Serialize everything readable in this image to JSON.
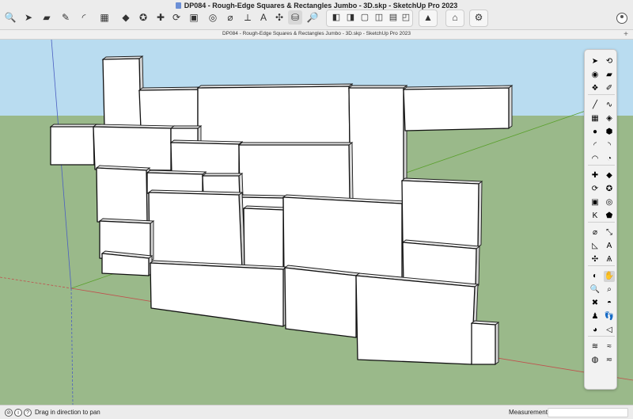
{
  "window": {
    "title": "DP084 - Rough-Edge Squares & Rectangles Jumbo - 3D.skp - SketchUp Pro 2023",
    "document_tab_title": "DP084 - Rough-Edge Squares & Rectangles Jumbo - 3D.skp - SketchUp Pro 2023",
    "new_tab_label": "+"
  },
  "toolbar": {
    "tools": [
      {
        "icon": "search-icon",
        "glyph": "🔍"
      },
      {
        "icon": "select-arrow-icon",
        "glyph": "➤"
      },
      {
        "icon": "eraser-icon",
        "glyph": "▰"
      },
      {
        "icon": "pencil-line-icon",
        "glyph": "✎"
      },
      {
        "icon": "arc-icon",
        "glyph": "◜"
      },
      {
        "icon": "rectangle-icon",
        "glyph": "▦"
      },
      {
        "icon": "push-pull-icon",
        "glyph": "◆"
      },
      {
        "icon": "follow-me-icon",
        "glyph": "✪"
      },
      {
        "icon": "move-icon",
        "glyph": "✚"
      },
      {
        "icon": "rotate-icon",
        "glyph": "⟳"
      },
      {
        "icon": "scale-icon",
        "glyph": "▣"
      },
      {
        "icon": "offset-icon",
        "glyph": "◎"
      },
      {
        "icon": "tape-measure-icon",
        "glyph": "⌀"
      },
      {
        "icon": "dimension-icon",
        "glyph": "⟂"
      },
      {
        "icon": "text-icon",
        "glyph": "A"
      },
      {
        "icon": "axes-icon",
        "glyph": "✣"
      },
      {
        "icon": "paint-bucket-icon",
        "glyph": "⛁"
      },
      {
        "icon": "zoom-icon",
        "glyph": "🔎"
      }
    ],
    "view_tools": [
      {
        "icon": "iso-view-icon",
        "glyph": "◧"
      },
      {
        "icon": "top-view-icon",
        "glyph": "◨"
      },
      {
        "icon": "front-view-icon",
        "glyph": "▢"
      },
      {
        "icon": "right-view-icon",
        "glyph": "◫"
      },
      {
        "icon": "back-view-icon",
        "glyph": "▤"
      },
      {
        "icon": "left-view-icon",
        "glyph": "◰"
      }
    ],
    "style_tool": {
      "icon": "styles-icon",
      "glyph": "▲"
    },
    "warehouse_tool": {
      "icon": "warehouse-icon",
      "glyph": "⌂"
    },
    "extension_tool": {
      "icon": "extension-icon",
      "glyph": "⚙"
    }
  },
  "palette": {
    "tools": [
      {
        "icon": "select-icon",
        "glyph": "➤"
      },
      {
        "icon": "orbit-icon",
        "glyph": "⟲"
      },
      {
        "icon": "paint-icon",
        "glyph": "◉"
      },
      {
        "icon": "eraser-icon",
        "glyph": "▰"
      },
      {
        "icon": "components-icon",
        "glyph": "❖"
      },
      {
        "icon": "tag-icon",
        "glyph": "✐"
      },
      {
        "icon": "line-icon",
        "glyph": "╱"
      },
      {
        "icon": "freehand-icon",
        "glyph": "∿"
      },
      {
        "icon": "rectangle-icon",
        "glyph": "▦"
      },
      {
        "icon": "rotated-rectangle-icon",
        "glyph": "◈"
      },
      {
        "icon": "circle-icon",
        "glyph": "●"
      },
      {
        "icon": "polygon-icon",
        "glyph": "⬢"
      },
      {
        "icon": "arc-icon",
        "glyph": "◜"
      },
      {
        "icon": "two-point-arc-icon",
        "glyph": "◝"
      },
      {
        "icon": "three-point-arc-icon",
        "glyph": "◠"
      },
      {
        "icon": "pie-icon",
        "glyph": "◔"
      },
      {
        "icon": "move-icon",
        "glyph": "✚"
      },
      {
        "icon": "push-pull-icon",
        "glyph": "◆"
      },
      {
        "icon": "rotate-icon",
        "glyph": "⟳"
      },
      {
        "icon": "follow-me-icon",
        "glyph": "✪"
      },
      {
        "icon": "scale-icon",
        "glyph": "▣"
      },
      {
        "icon": "offset-icon",
        "glyph": "◎"
      },
      {
        "icon": "flip-icon",
        "glyph": "K"
      },
      {
        "icon": "solid-tools-icon",
        "glyph": "⬟"
      },
      {
        "icon": "tape-measure-icon",
        "glyph": "⌀"
      },
      {
        "icon": "dimension-icon",
        "glyph": "⤡"
      },
      {
        "icon": "protractor-icon",
        "glyph": "◺"
      },
      {
        "icon": "text-icon",
        "glyph": "A"
      },
      {
        "icon": "axes-icon",
        "glyph": "✣"
      },
      {
        "icon": "3d-text-icon",
        "glyph": "Ѧ"
      },
      {
        "icon": "section-plane-icon",
        "glyph": "◐"
      },
      {
        "icon": "pan-icon",
        "glyph": "✋"
      },
      {
        "icon": "zoom-icon",
        "glyph": "🔍"
      },
      {
        "icon": "zoom-window-icon",
        "glyph": "⌕"
      },
      {
        "icon": "zoom-extents-icon",
        "glyph": "✖"
      },
      {
        "icon": "previous-view-icon",
        "glyph": "◓"
      },
      {
        "icon": "position-camera-icon",
        "glyph": "♟"
      },
      {
        "icon": "walk-icon",
        "glyph": "👣"
      },
      {
        "icon": "look-around-icon",
        "glyph": "◕"
      },
      {
        "icon": "sound-icon",
        "glyph": "◁"
      },
      {
        "icon": "sandbox-from-contours-icon",
        "glyph": "≋"
      },
      {
        "icon": "sandbox-scratch-icon",
        "glyph": "≈"
      },
      {
        "icon": "smoove-icon",
        "glyph": "◍"
      },
      {
        "icon": "stamp-icon",
        "glyph": "≂"
      }
    ]
  },
  "colors": {
    "sky": "#b9dcf0",
    "ground": "#9ab98a",
    "block_face": "#ffffff",
    "block_side": "#d7d7d7",
    "axis_red": "#c0504d",
    "axis_green": "#5aa02c",
    "axis_blue": "#4a5fc1"
  },
  "status": {
    "message": "Drag in direction to pan",
    "measurements_label": "Measurements",
    "measurements_value": ""
  }
}
